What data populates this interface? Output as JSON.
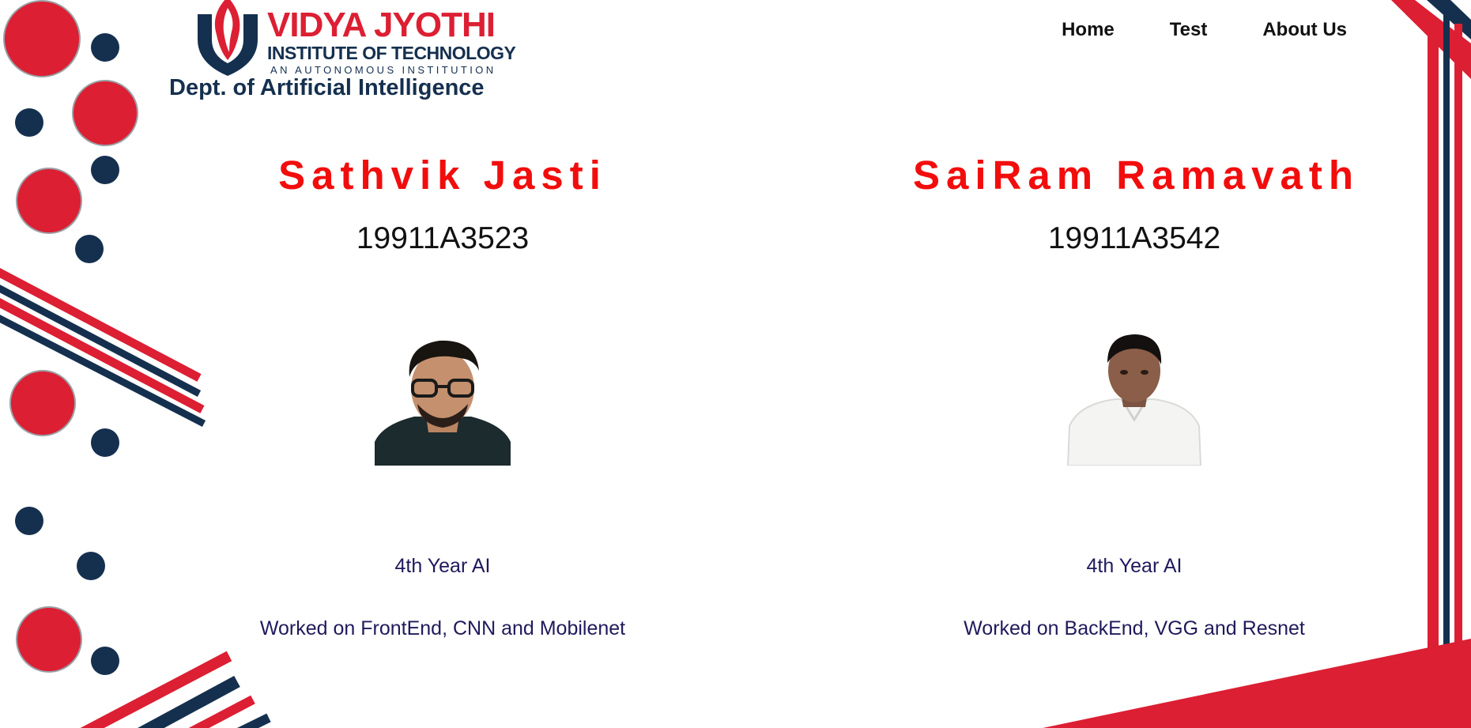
{
  "header": {
    "logo": {
      "title": "VIDYA JYOTHI",
      "subtitle": "INSTITUTE OF TECHNOLOGY",
      "tagline": "AN AUTONOMOUS INSTITUTION"
    },
    "department": "Dept. of Artificial Intelligence",
    "nav": [
      {
        "label": "Home"
      },
      {
        "label": "Test"
      },
      {
        "label": "About Us"
      }
    ]
  },
  "students": [
    {
      "name": "Sathvik Jasti",
      "roll": "19911A3523",
      "year": "4th Year AI",
      "work": "Worked on FrontEnd, CNN and Mobilenet"
    },
    {
      "name": "SaiRam Ramavath",
      "roll": "19911A3542",
      "year": "4th Year AI",
      "work": "Worked on BackEnd, VGG and Resnet"
    }
  ],
  "colors": {
    "red": "#dc1f33",
    "navy": "#15304f",
    "name_red": "#f20d0d",
    "body_text": "#1f1a5c"
  }
}
